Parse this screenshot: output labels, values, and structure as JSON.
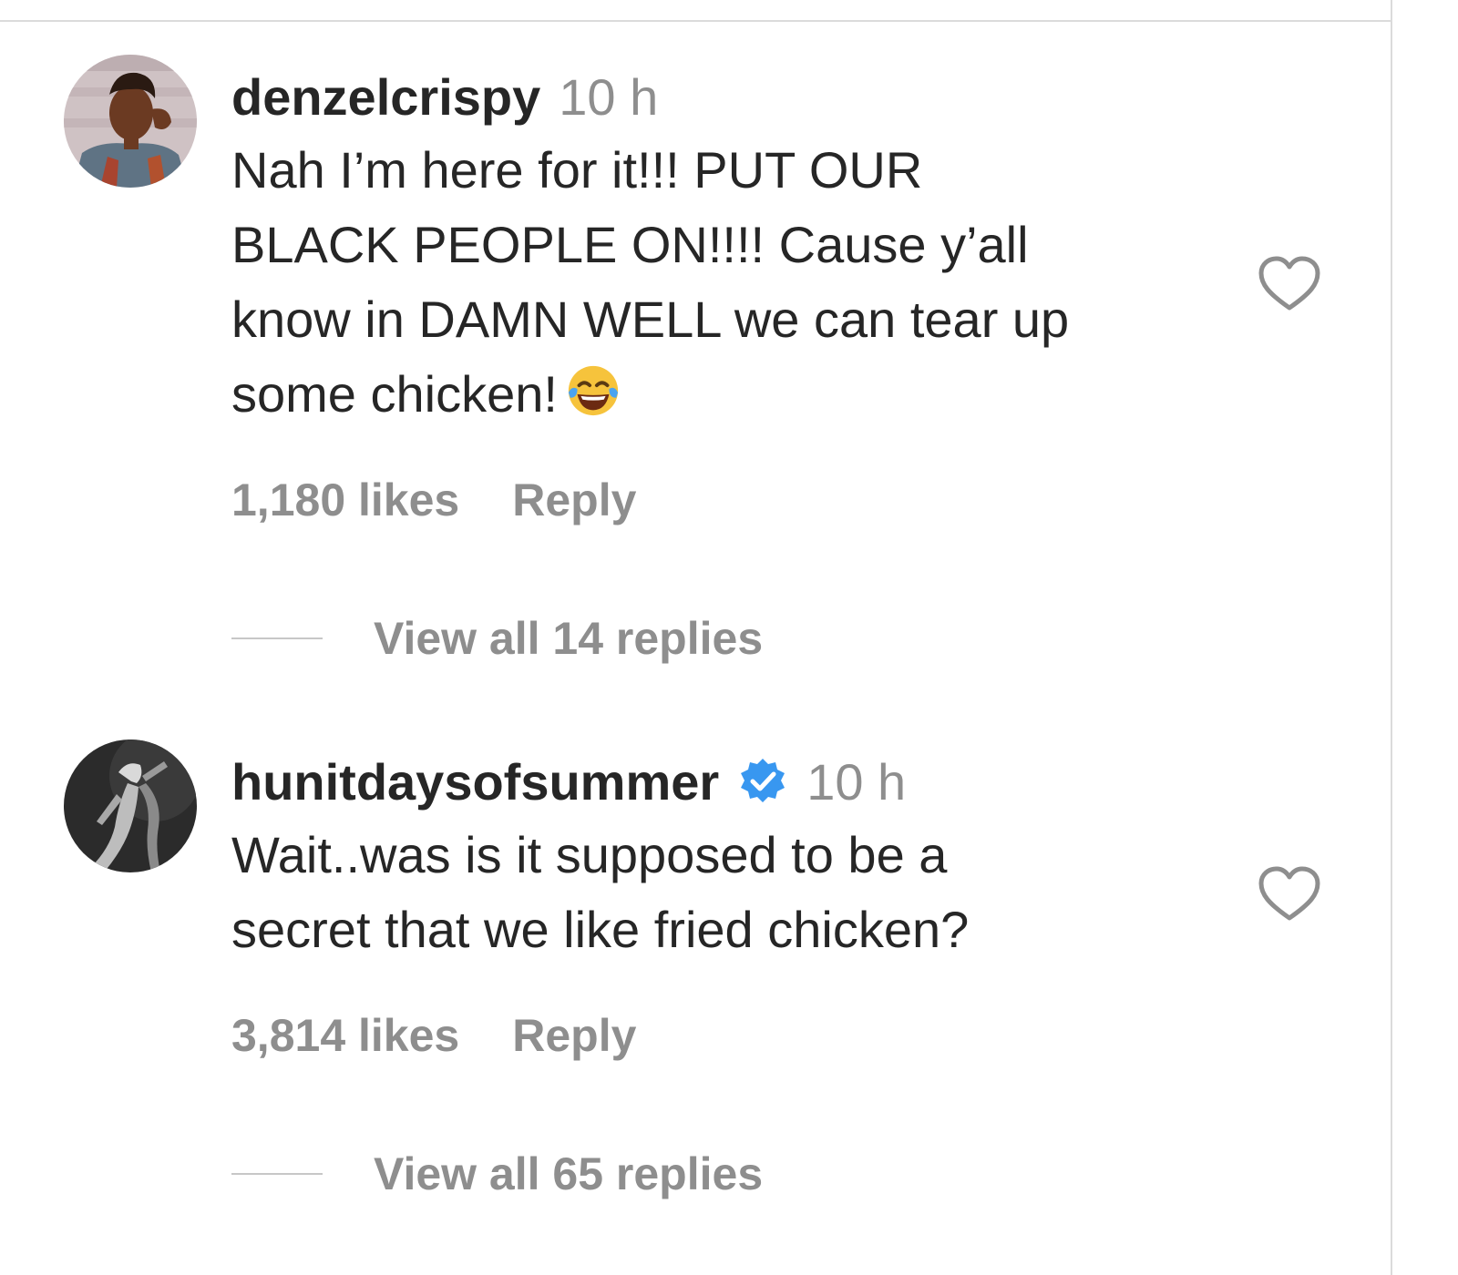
{
  "comments": [
    {
      "username": "denzelcrispy",
      "time": "10 h",
      "verified": false,
      "text_lines": [
        "Nah I’m here for it!!! PUT OUR",
        "BLACK PEOPLE ON!!!! Cause y’all",
        "know in DAMN WELL we can tear up",
        "some chicken!"
      ],
      "emoji": "tears-of-joy-emoji",
      "likes": "1,180 likes",
      "reply_label": "Reply",
      "view_replies": "View all 14 replies",
      "avatar_icon": "avatar-photo-man",
      "like_icon": "heart-outline-icon"
    },
    {
      "username": "hunitdaysofsummer",
      "time": "10 h",
      "verified": true,
      "text_lines": [
        "Wait..was is it supposed to be a",
        "secret that we like fried chicken?"
      ],
      "likes": "3,814 likes",
      "reply_label": "Reply",
      "view_replies": "View all 65 replies",
      "avatar_icon": "avatar-photo-dark",
      "like_icon": "heart-outline-icon"
    }
  ],
  "colors": {
    "text_primary": "#262626",
    "text_secondary": "#8e8e8e",
    "verified_blue": "#3897f0",
    "divider": "#dbdbdb"
  }
}
